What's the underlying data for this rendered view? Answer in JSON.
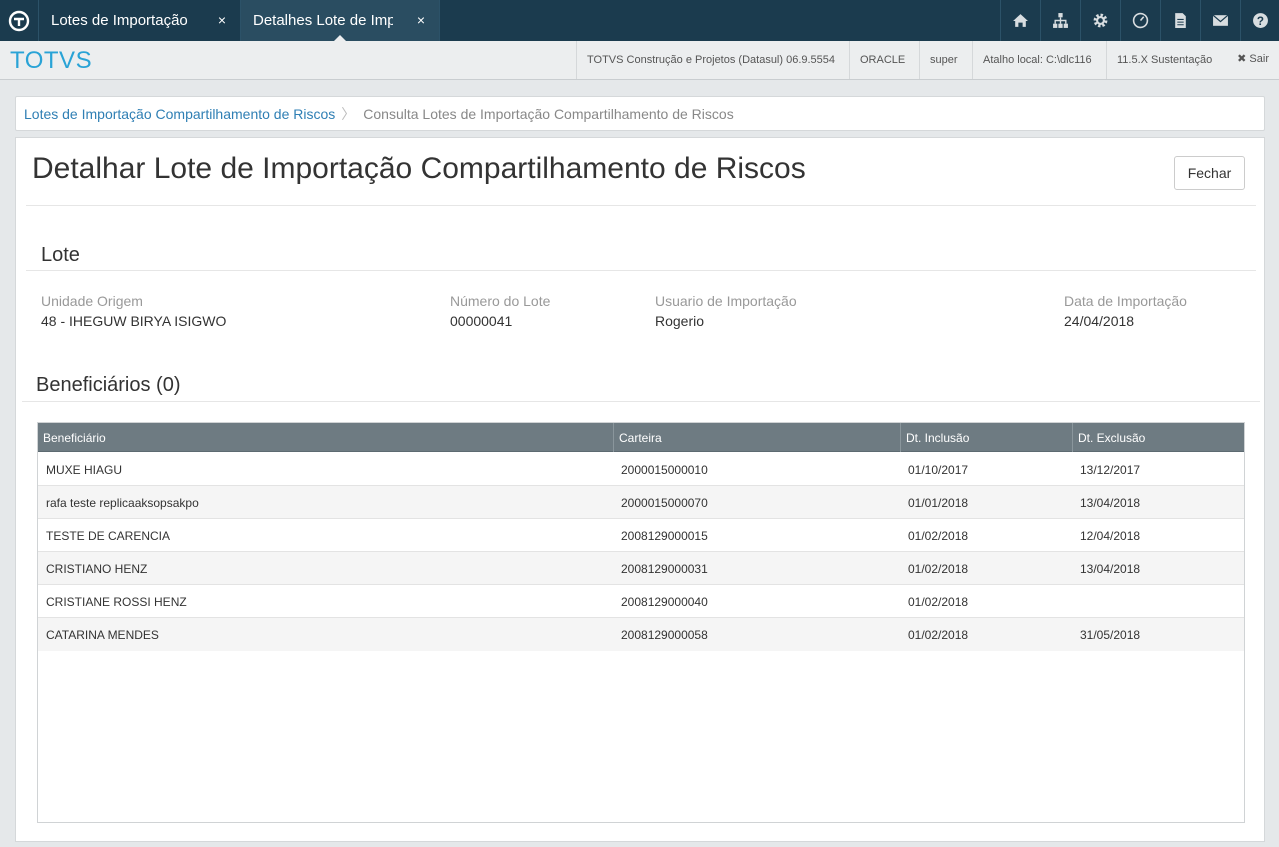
{
  "tabs": [
    {
      "label": "Lotes de Importação Compartilhamento de Riscos",
      "close": "×"
    },
    {
      "label": "Detalhes Lote de Importação",
      "close": "×"
    }
  ],
  "toolbar_icons": [
    "home-icon",
    "sitemap-icon",
    "gear-icon",
    "clock-icon",
    "document-icon",
    "mail-icon",
    "help-icon"
  ],
  "brand": "TOTVS",
  "header_info": {
    "product": "TOTVS Construção e Projetos (Datasul) 06.9.5554",
    "database": "ORACLE",
    "user": "super",
    "shortcut": "Atalho local: C:\\dlc116",
    "version": "11.5.X Sustentação",
    "logout": "✖ Sair"
  },
  "breadcrumb": {
    "link": "Lotes de Importação Compartilhamento de Riscos",
    "separator": "〉",
    "current": "Consulta Lotes de Importação Compartilhamento de Riscos"
  },
  "page": {
    "title": "Detalhar Lote de Importação Compartilhamento de Riscos",
    "close_button": "Fechar"
  },
  "lote": {
    "section_title": "Lote",
    "fields": [
      {
        "label": "Unidade Origem",
        "value": "48 - IHEGUW BIRYA ISIGWO"
      },
      {
        "label": "Número do Lote",
        "value": "00000041"
      },
      {
        "label": "Usuario de Importação",
        "value": "Rogerio"
      },
      {
        "label": "Data de Importação",
        "value": "24/04/2018"
      }
    ]
  },
  "beneficiarios": {
    "section_title": "Beneficiários (0)",
    "columns": [
      "Beneficiário",
      "Carteira",
      "Dt. Inclusão",
      "Dt. Exclusão"
    ],
    "rows": [
      [
        "MUXE HIAGU",
        "2000015000010",
        "01/10/2017",
        "13/12/2017"
      ],
      [
        "rafa teste replicaaksopsakpo",
        "2000015000070",
        "01/01/2018",
        "13/04/2018"
      ],
      [
        "TESTE DE CARENCIA",
        "2008129000015",
        "01/02/2018",
        "12/04/2018"
      ],
      [
        "CRISTIANO HENZ",
        "2008129000031",
        "01/02/2018",
        "13/04/2018"
      ],
      [
        "CRISTIANE ROSSI HENZ",
        "2008129000040",
        "01/02/2018",
        ""
      ],
      [
        "CATARINA MENDES",
        "2008129000058",
        "01/02/2018",
        "31/05/2018"
      ]
    ]
  },
  "colors": {
    "topbar": "#1b3b4e",
    "brand": "#29a3d6",
    "link": "#2f7fb4",
    "grid_header": "#6e7b82"
  }
}
